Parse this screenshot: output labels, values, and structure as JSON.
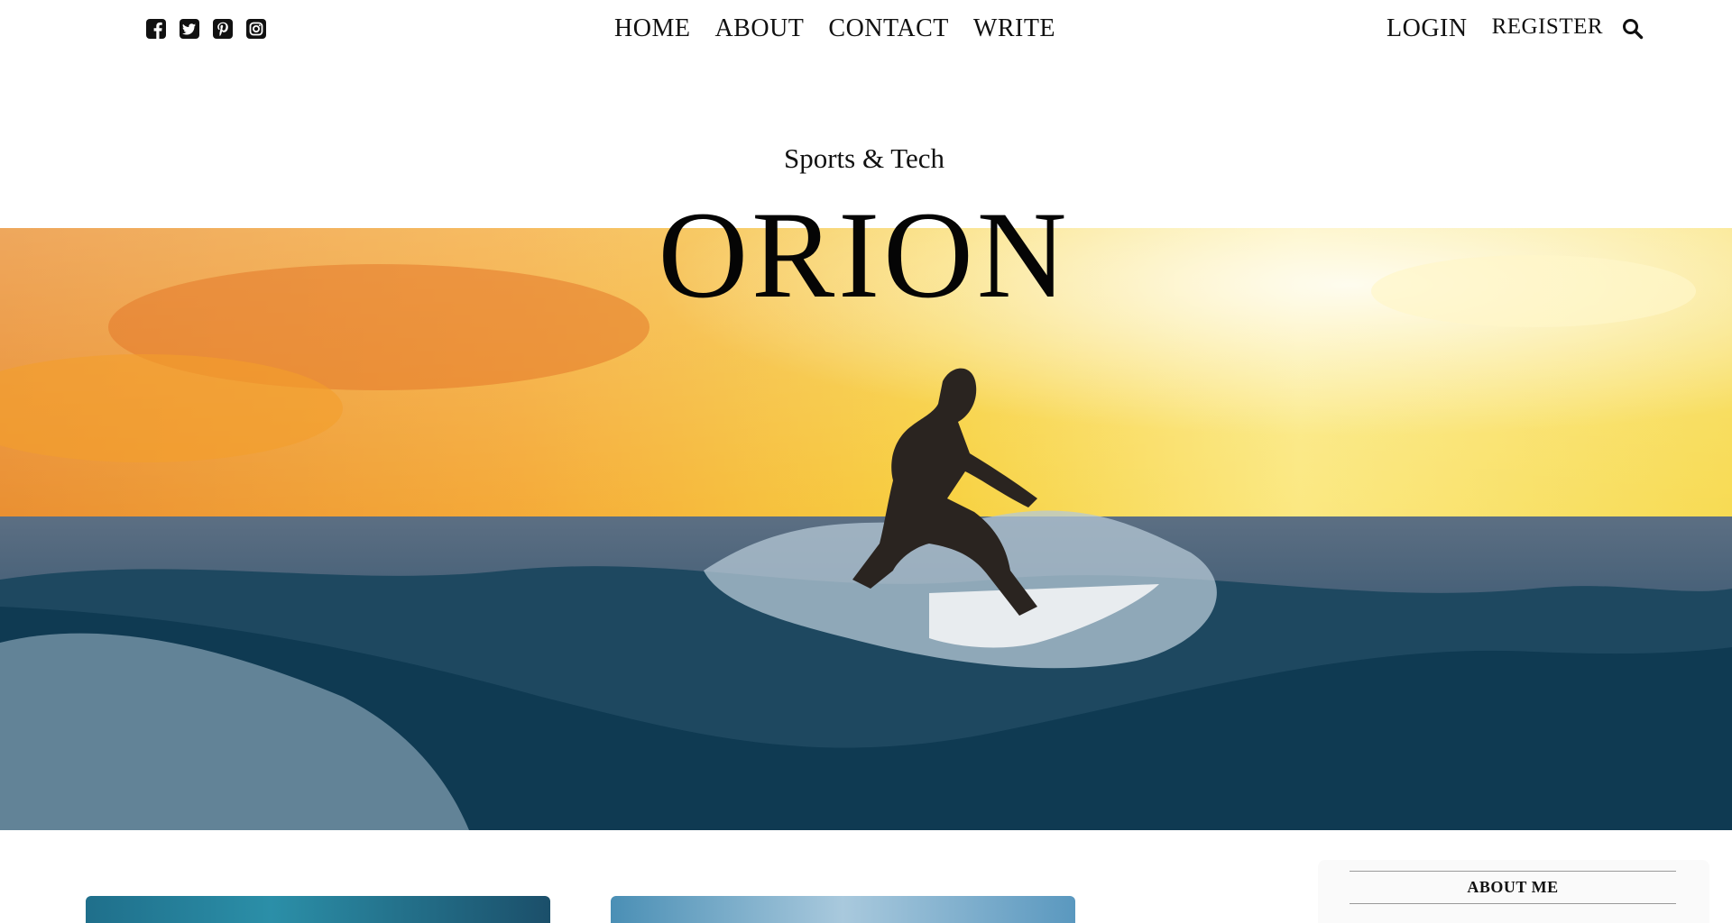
{
  "social": {
    "icons": [
      "facebook-square-icon",
      "twitter-square-icon",
      "pinterest-square-icon",
      "instagram-icon"
    ]
  },
  "nav": {
    "items": [
      {
        "label": "HOME"
      },
      {
        "label": "ABOUT"
      },
      {
        "label": "CONTACT"
      },
      {
        "label": "WRITE"
      }
    ]
  },
  "auth": {
    "login": "LOGIN",
    "register": "REGISTER",
    "search_icon": "search-icon"
  },
  "header": {
    "subtitle": "Sports & Tech",
    "brand": "ORION"
  },
  "hero": {
    "image": "surfer-at-sunset"
  },
  "sidebar": {
    "title": "ABOUT ME"
  },
  "colors": {
    "text": "#111111",
    "background": "#ffffff",
    "sidebar_bg": "#fafafa"
  }
}
